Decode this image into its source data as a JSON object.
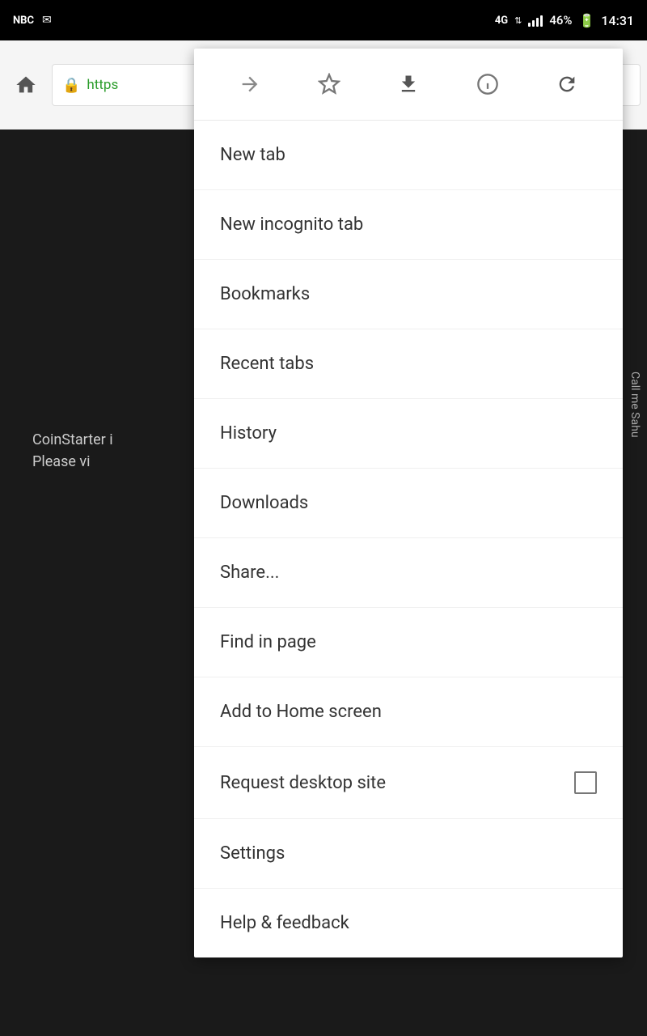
{
  "statusBar": {
    "network": "4G",
    "signal": "full",
    "battery": "46%",
    "time": "14:31"
  },
  "browser": {
    "addressText": "https",
    "homeLabel": "Home"
  },
  "webpage": {
    "line1": "CoinStarter i",
    "line2": "Please vi",
    "sideLabel": "Call me Sahu"
  },
  "toolbar": {
    "forward": "→",
    "bookmark": "☆",
    "download": "⬇",
    "info": "ⓘ",
    "refresh": "↺"
  },
  "menu": {
    "items": [
      {
        "id": "new-tab",
        "label": "New tab",
        "hasCheckbox": false
      },
      {
        "id": "new-incognito-tab",
        "label": "New incognito tab",
        "hasCheckbox": false
      },
      {
        "id": "bookmarks",
        "label": "Bookmarks",
        "hasCheckbox": false
      },
      {
        "id": "recent-tabs",
        "label": "Recent tabs",
        "hasCheckbox": false
      },
      {
        "id": "history",
        "label": "History",
        "hasCheckbox": false
      },
      {
        "id": "downloads",
        "label": "Downloads",
        "hasCheckbox": false
      },
      {
        "id": "share",
        "label": "Share...",
        "hasCheckbox": false
      },
      {
        "id": "find-in-page",
        "label": "Find in page",
        "hasCheckbox": false
      },
      {
        "id": "add-to-home-screen",
        "label": "Add to Home screen",
        "hasCheckbox": false
      },
      {
        "id": "request-desktop-site",
        "label": "Request desktop site",
        "hasCheckbox": true
      },
      {
        "id": "settings",
        "label": "Settings",
        "hasCheckbox": false
      },
      {
        "id": "help-feedback",
        "label": "Help & feedback",
        "hasCheckbox": false
      }
    ]
  }
}
